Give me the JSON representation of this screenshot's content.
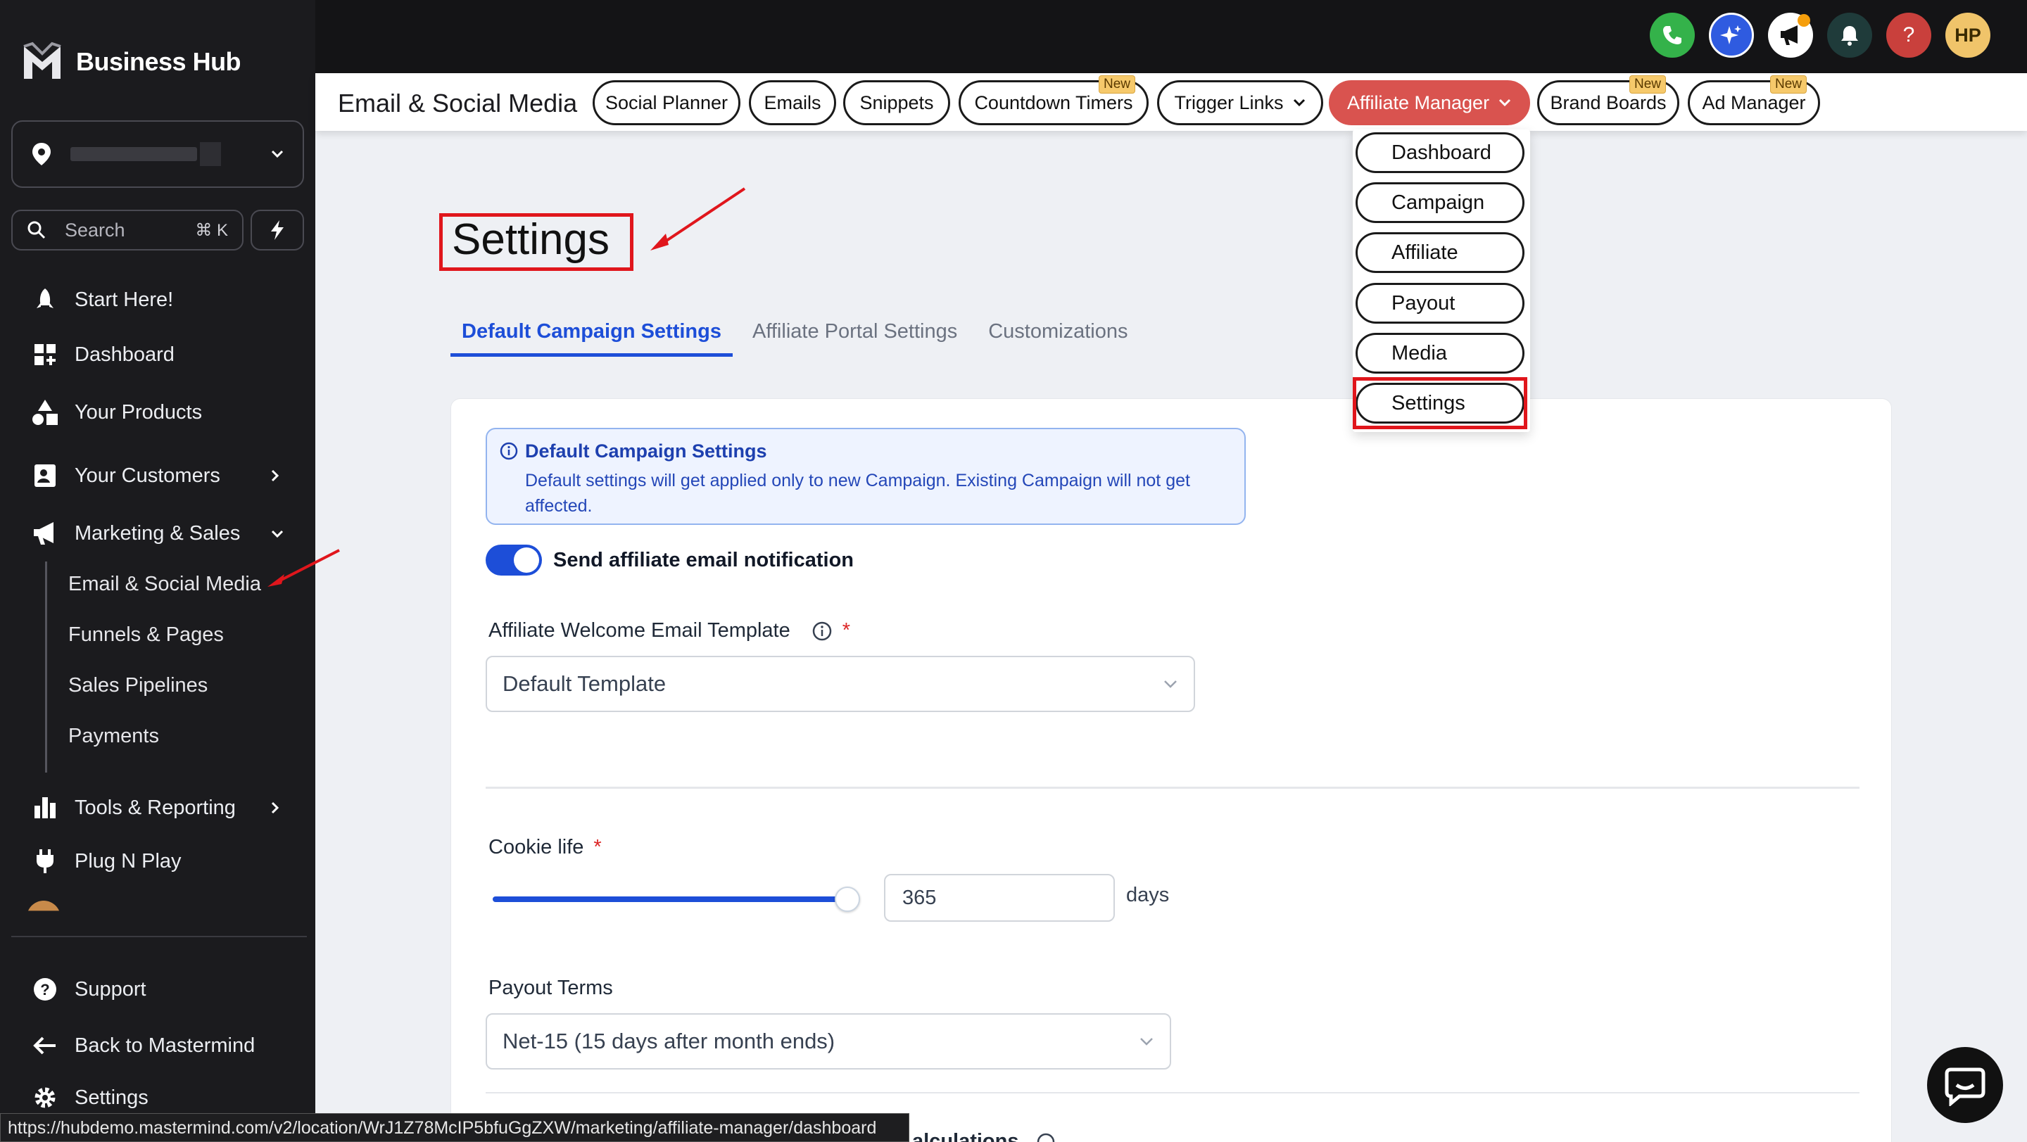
{
  "sidebar": {
    "brand": "Business Hub",
    "search_label": "Search",
    "search_shortcut": "⌘ K",
    "items": {
      "start": "Start Here!",
      "dashboard": "Dashboard",
      "products": "Your Products",
      "customers": "Your Customers",
      "marketing": "Marketing & Sales",
      "tools": "Tools & Reporting",
      "plug": "Plug N Play",
      "support": "Support",
      "back": "Back to Mastermind",
      "settings": "Settings"
    },
    "marketing_sub": {
      "email": "Email & Social Media",
      "funnels": "Funnels & Pages",
      "pipelines": "Sales Pipelines",
      "payments": "Payments"
    }
  },
  "status_url": "https://hubdemo.mastermind.com/v2/location/WrJ1Z78McIP5bfuGgZXW/marketing/affiliate-manager/dashboard",
  "topbar": {
    "avatar_initials": "HP",
    "help_glyph": "?"
  },
  "subheader": {
    "title": "Email & Social Media",
    "tabs": {
      "social": "Social Planner",
      "emails": "Emails",
      "snippets": "Snippets",
      "countdown": "Countdown Timers",
      "trigger": "Trigger Links",
      "affiliate": "Affiliate Manager",
      "brand": "Brand Boards",
      "ads": "Ad Manager"
    },
    "new_badge": "New"
  },
  "dropdown": {
    "dashboard": "Dashboard",
    "campaign": "Campaign",
    "affiliate": "Affiliate",
    "payout": "Payout",
    "media": "Media",
    "settings": "Settings"
  },
  "page": {
    "title": "Settings",
    "tabs": {
      "default": "Default Campaign Settings",
      "portal": "Affiliate Portal Settings",
      "custom": "Customizations"
    },
    "info": {
      "heading": "Default Campaign Settings",
      "text": "Default settings will get applied only to new Campaign. Existing Campaign will not get affected."
    },
    "notify_label": "Send affiliate email notification",
    "notify_on": true,
    "welcome_label": "Affiliate Welcome Email Template",
    "welcome_value": "Default Template",
    "cookie_label": "Cookie life",
    "cookie_value": "365",
    "cookie_unit": "days",
    "payout_label": "Payout Terms",
    "payout_value": "Net-15 (15 days after month ends)",
    "cut_heading": "alculations",
    "required_mark": "*"
  },
  "colors": {
    "accent": "#1d4ed8",
    "active_tab": "#d9534f",
    "highlight": "#e0161c",
    "sidebar_bg": "#1b1b1e"
  }
}
